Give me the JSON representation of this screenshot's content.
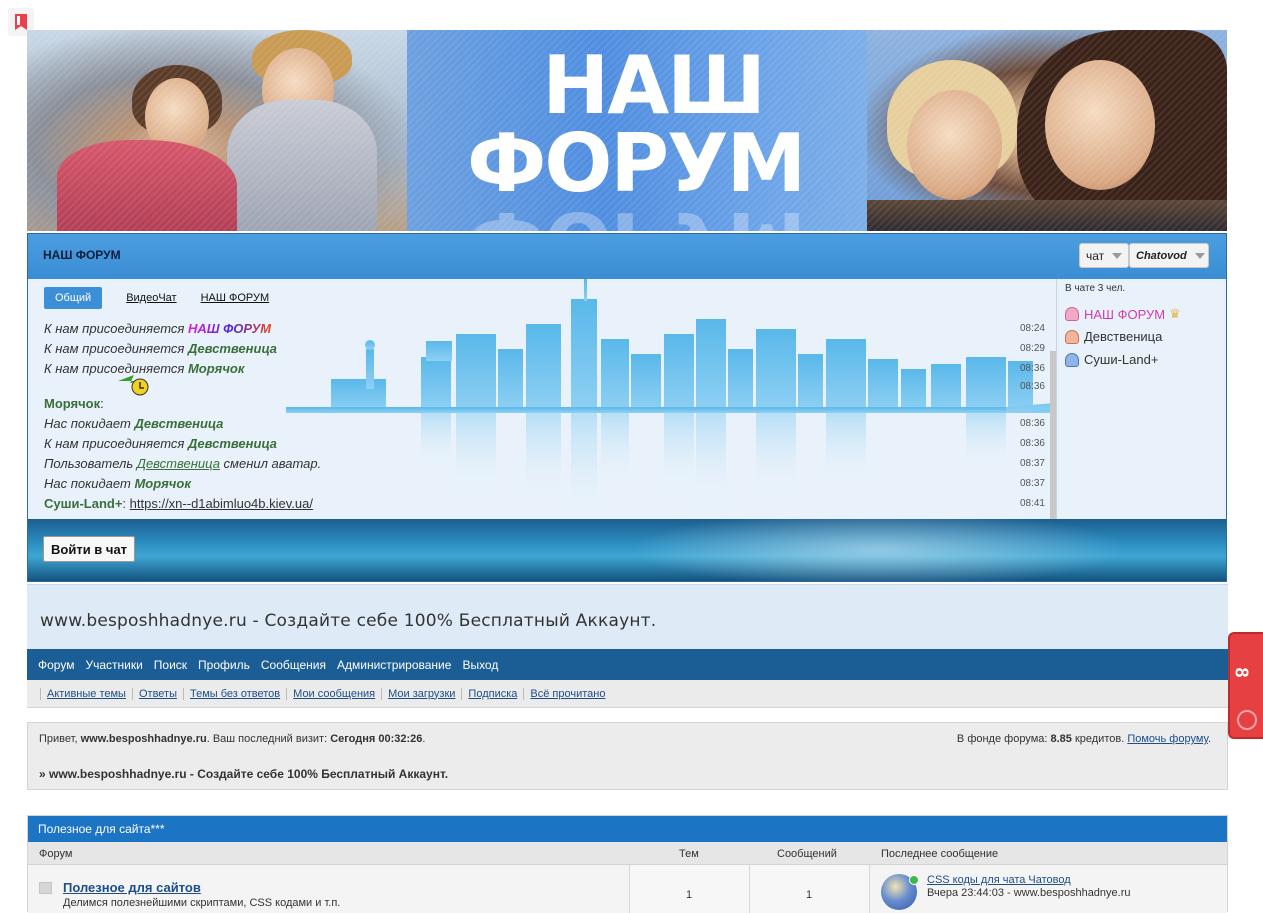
{
  "banner": {
    "line1": "НАШ",
    "line2": "ФОРУМ"
  },
  "chat": {
    "title": "НАШ ФОРУМ",
    "select_left": "чат",
    "select_right": "Chatovod",
    "tabs": [
      "Общий",
      "ВидеоЧат",
      "НАШ ФОРУМ"
    ],
    "messages": [
      {
        "pre": "К нам присоединяется ",
        "nick": "НАШ ФОРУМ",
        "post": "",
        "time": "08:24"
      },
      {
        "pre": "К нам присоединяется ",
        "nick": "Девственица",
        "post": "",
        "time": "08:29"
      },
      {
        "pre": "К нам присоединяется ",
        "nick": "Морячок",
        "post": "",
        "time": "08:36"
      },
      {
        "pre": "",
        "nick": "",
        "post": "",
        "time": "08:36"
      },
      {
        "pre": "",
        "nick": "Морячок",
        "post": ":",
        "time": ""
      },
      {
        "pre": "Нас покидает ",
        "nick": "Девственица",
        "post": "",
        "time": "08:36"
      },
      {
        "pre": "К нам присоединяется ",
        "nick": "Девственица",
        "post": "",
        "time": "08:36"
      },
      {
        "pre": "Пользователь ",
        "nick": "Девственица",
        "post": " сменил аватар.",
        "time": "08:37"
      },
      {
        "pre": "Нас покидает ",
        "nick": "Морячок",
        "post": "",
        "time": "08:37"
      },
      {
        "pre": "",
        "nick": "Суши-Land+",
        "post": ": ",
        "link": "https://xn--d1abimluo4b.kiev.ua/",
        "time": "08:41"
      }
    ],
    "users_count": "В чате 3 чел.",
    "users": [
      "НАШ ФОРУМ",
      "Девственица",
      "Суши-Land+"
    ],
    "enter_button": "Войти в чат"
  },
  "site_title": "www.besposhhadnye.ru - Создайте себе 100% Бесплатный Аккаунт.",
  "nav": [
    "Форум",
    "Участники",
    "Поиск",
    "Профиль",
    "Сообщения",
    "Администрирование",
    "Выход"
  ],
  "subnav": [
    "Активные темы",
    "Ответы",
    "Темы без ответов",
    "Мои сообщения",
    "Мои загрузки",
    "Подписка",
    "Всё прочитано"
  ],
  "welcome": {
    "hello": "Привет, ",
    "user": "www.besposhhadnye.ru",
    "last_visit_label": ". Ваш последний визит: ",
    "last_visit": "Сегодня 00:32:26",
    "fund_label": "В фонде форума: ",
    "fund_value": "8.85",
    "fund_unit": " кредитов. ",
    "fund_link": "Помочь форуму",
    "crumb": "» www.besposhhadnye.ru - Создайте себе 100% Бесплатный Аккаунт."
  },
  "category": {
    "title": "Полезное для сайта***",
    "col_forum": "Форум",
    "col_topics": "Тем",
    "col_posts": "Сообщений",
    "col_last": "Последнее сообщение",
    "forum": {
      "name": "Полезное для сайтов",
      "desc": "Делимся полезнейшими скриптами, CSS кодами и т.п.",
      "topics": "1",
      "posts": "1",
      "last_topic": "CSS коды для чата Чатовод",
      "last_meta": "Вчера 23:44:03 - www.besposhhadnye.ru"
    }
  },
  "side_widget": {
    "count": "8"
  }
}
